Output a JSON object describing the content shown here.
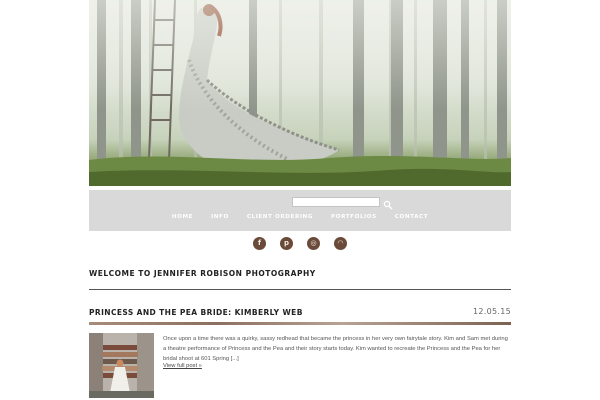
{
  "header": {
    "hero_image": "misty-forest-woman-in-butterfly-dress-banner"
  },
  "search": {
    "placeholder": "",
    "button_icon": "search-icon"
  },
  "nav": {
    "items": [
      {
        "label": "HOME"
      },
      {
        "label": "INFO"
      },
      {
        "label": "CLIENT ORDERING"
      },
      {
        "label": "PORTFOLIOS"
      },
      {
        "label": "CONTACT"
      }
    ]
  },
  "social": {
    "color": "#6b4a3a",
    "icons": [
      {
        "name": "facebook-icon",
        "glyph": "f"
      },
      {
        "name": "pinterest-icon",
        "glyph": "p"
      },
      {
        "name": "instagram-icon",
        "glyph": "◎"
      },
      {
        "name": "rss-icon",
        "glyph": "◠"
      }
    ]
  },
  "page": {
    "welcome": "WELCOME TO JENNIFER ROBISON PHOTOGRAPHY"
  },
  "post": {
    "title": "PRINCESS AND THE PEA BRIDE: KIMBERLY WEB",
    "date": "12.05.15",
    "excerpt": "Once upon a time there was a quirky, sassy redhead that became the princess in her very own fairytale story. Kim and Sam met during a theatre performance of Princess and the Pea and their story starts today.   Kim wanted to recreate the Princess and the Pea for her bridal shoot at 601 Spring [...]",
    "read_more": "View full post »",
    "thumbnail": "bride-on-stacked-mattresses-photo"
  }
}
